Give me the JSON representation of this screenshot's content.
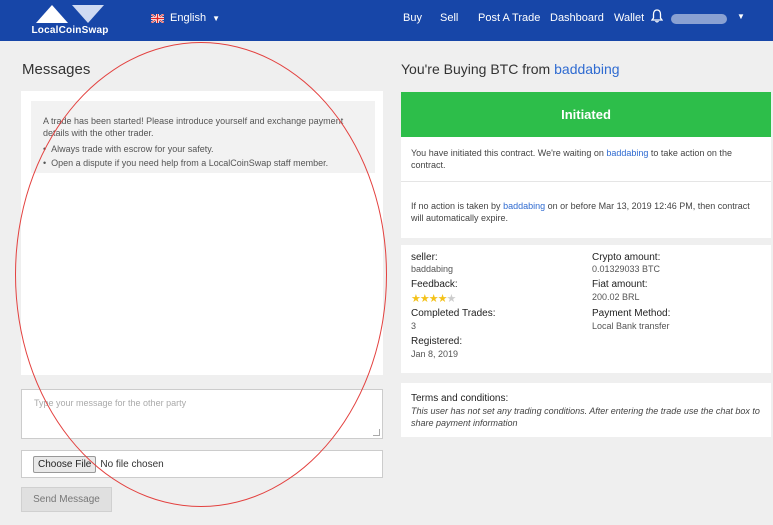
{
  "header": {
    "logo_text": "LocalCoinSwap",
    "language": "English",
    "nav": [
      "Buy",
      "Sell",
      "Post A Trade",
      "Dashboard",
      "Wallet"
    ]
  },
  "messages": {
    "title": "Messages",
    "system_intro": "A trade has been started! Please introduce yourself and exchange payment details with the other trader.",
    "system_tips": [
      "Always trade with escrow for your safety.",
      "Open a dispute if you need help from a LocalCoinSwap staff member."
    ],
    "input_placeholder": "Type your message for the other party",
    "choose_file_label": "Choose File",
    "no_file_text": "No file chosen",
    "send_label": "Send Message"
  },
  "trade": {
    "heading_prefix": "You're Buying BTC from ",
    "counterparty": "baddabing",
    "status": "Initiated",
    "info1_before": "You have initiated this contract. We're waiting on ",
    "info1_user": "baddabing",
    "info1_after": " to take action on the contract.",
    "info2_before": "If no action is taken by ",
    "info2_user": "baddabing",
    "info2_after": " on or before Mar 13, 2019 12:46 PM, then contract will automatically expire.",
    "seller_label": "seller:",
    "seller_value": "baddabing",
    "feedback_label": "Feedback:",
    "feedback_stars": 4,
    "feedback_max": 5,
    "completed_label": "Completed Trades:",
    "completed_value": "3",
    "registered_label": "Registered:",
    "registered_value": "Jan 8, 2019",
    "crypto_label": "Crypto amount:",
    "crypto_value": "0.01329033 BTC",
    "fiat_label": "Fiat amount:",
    "fiat_value": "200.02 BRL",
    "payment_label": "Payment Method:",
    "payment_value": "Local Bank transfer",
    "terms_label": "Terms and conditions:",
    "terms_text": "This user has not set any trading conditions. After entering the trade use the chat box to share payment information"
  },
  "colors": {
    "header_bg": "#1746a8",
    "status_green": "#2dbe4a",
    "link_blue": "#2f6bd1",
    "annotation_red": "#e3413f",
    "star_gold": "#f4c21a"
  }
}
